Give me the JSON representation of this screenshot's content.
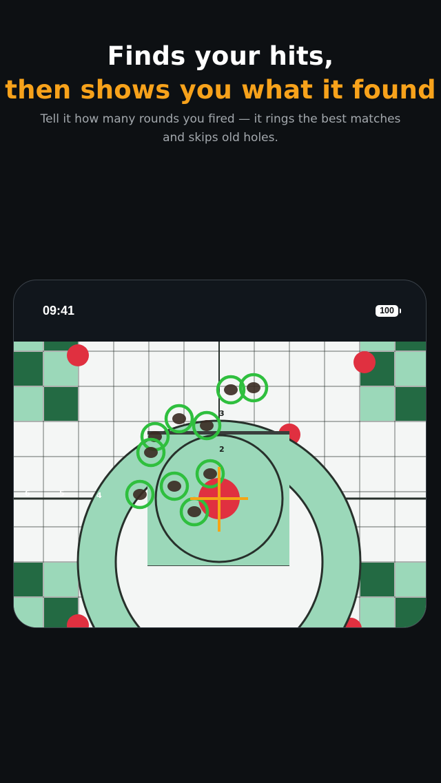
{
  "headline": {
    "line1": "Finds your hits,",
    "line2": "then shows you what it found"
  },
  "subtitle": {
    "line1": "Tell it how many rounds you fired — it rings the best matches",
    "line2": "and skips old holes."
  },
  "phone": {
    "status_time": "09:41",
    "battery": "100"
  },
  "target": {
    "ring_labels": [
      "6",
      "5",
      "4",
      "3",
      "2"
    ],
    "colors": {
      "dark_green": "#236a43",
      "light_green": "#9bd8b9",
      "white": "#f4f6f5",
      "red": "#e03040",
      "hit_ring": "#2fbf3e",
      "crosshair": "#f5a515",
      "line": "#27302b"
    },
    "detected_hits_count": 10,
    "crosshair": "center-aim-point"
  }
}
